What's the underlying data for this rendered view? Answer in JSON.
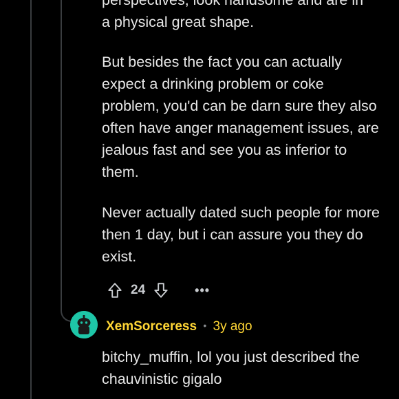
{
  "parent_comment": {
    "partial_first_line": "perspectives, look handsome and are in",
    "paragraphs": [
      "a physical great shape.",
      "But besides the fact you can actually expect a drinking problem or coke problem, you'd can be darn sure they also often have anger management issues, are jealous fast and see you as inferior to them.",
      "Never actually dated such people for more then 1 day, but i can assure you they do exist."
    ],
    "score": "24",
    "more_label": "•••"
  },
  "reply": {
    "author": "XemSorceress",
    "separator": "•",
    "time": "3y ago",
    "text": "bitchy_muffin, lol you just described the chauvinistic gigalo",
    "avatar_color": "#1ec6a8"
  },
  "colors": {
    "background": "#000000",
    "text": "#e6e6e6",
    "author": "#ffd635",
    "thread_line": "#3a3d40",
    "icon": "#c8cbcf"
  },
  "icons": {
    "upvote": "arrow-up-outline-icon",
    "downvote": "arrow-down-outline-icon",
    "more": "ellipsis-icon",
    "avatar": "snoo-avatar-icon"
  }
}
